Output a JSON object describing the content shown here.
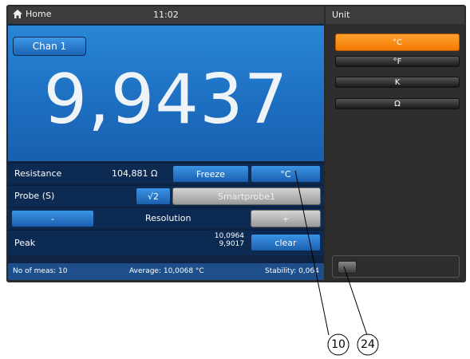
{
  "topbar": {
    "home_label": "Home",
    "time": "11:02"
  },
  "main": {
    "channel_button": "Chan 1",
    "reading": "9,9437"
  },
  "rows": {
    "resistance": {
      "label": "Resistance",
      "value": "104,881 Ω",
      "freeze_label": "Freeze",
      "unit_label": "°C"
    },
    "probe": {
      "label": "Probe (S)",
      "sqrt_label": "√2",
      "probe_name": "Smartprobe1"
    },
    "resolution": {
      "minus_label": "-",
      "label": "Resolution",
      "plus_label": "+"
    },
    "peak": {
      "label": "Peak",
      "max": "10,0964",
      "min": "9,9017",
      "clear_label": "clear"
    }
  },
  "status": {
    "measurements": "No of meas: 10",
    "average": "Average: 10,0068 °C",
    "stability": "Stability: 0,064"
  },
  "unit_panel": {
    "title": "Unit",
    "options": [
      "°C",
      "°F",
      "K",
      "Ω"
    ],
    "selected": "°C"
  },
  "callouts": [
    "10",
    "24"
  ],
  "colors": {
    "accent_orange": "#f28a10",
    "panel_blue": "#1d6fc2",
    "dark_navy": "#0c2a52"
  }
}
